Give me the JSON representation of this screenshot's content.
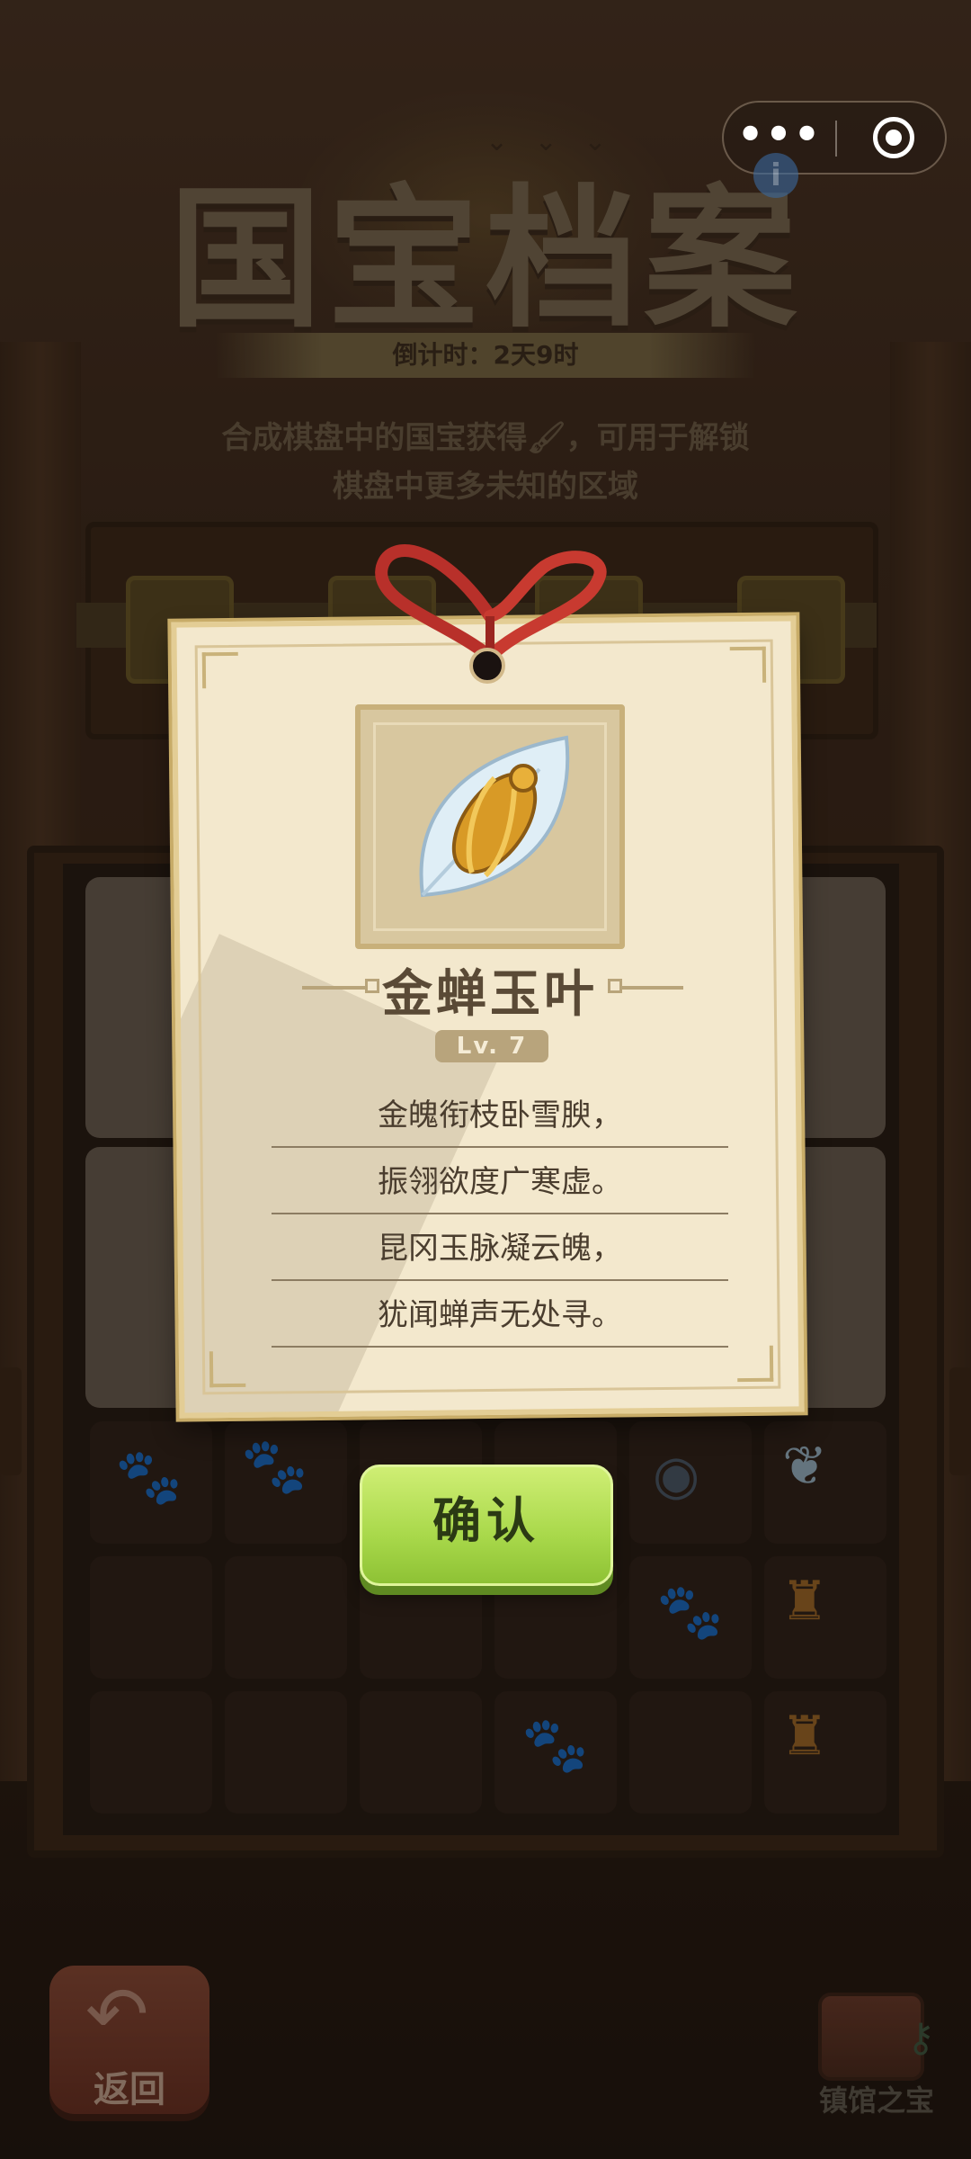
{
  "window": {
    "title": "国宝档案",
    "countdown": "倒计时：2天9时",
    "description_line1": "合成棋盘中的国宝获得🖌，可用于解锁",
    "description_line2": "棋盘中更多未知的区域"
  },
  "capsule": {
    "more_icon": "•••",
    "close_icon": "target-icon"
  },
  "modal": {
    "item_name": "金蝉玉叶",
    "level": "Lv. 7",
    "poem": [
      "金魄衔枝卧雪腴，",
      "振翎欲度广寒虚。",
      "昆冈玉脉凝云魄，",
      "犹闻蝉声无处寻。"
    ],
    "confirm_label": "确认"
  },
  "bottom": {
    "back_label": "返回",
    "treasure_label": "镇馆之宝"
  },
  "colors": {
    "card": "#f3e8cd",
    "confirm": "#a8d84a",
    "title": "#7a6a52"
  }
}
